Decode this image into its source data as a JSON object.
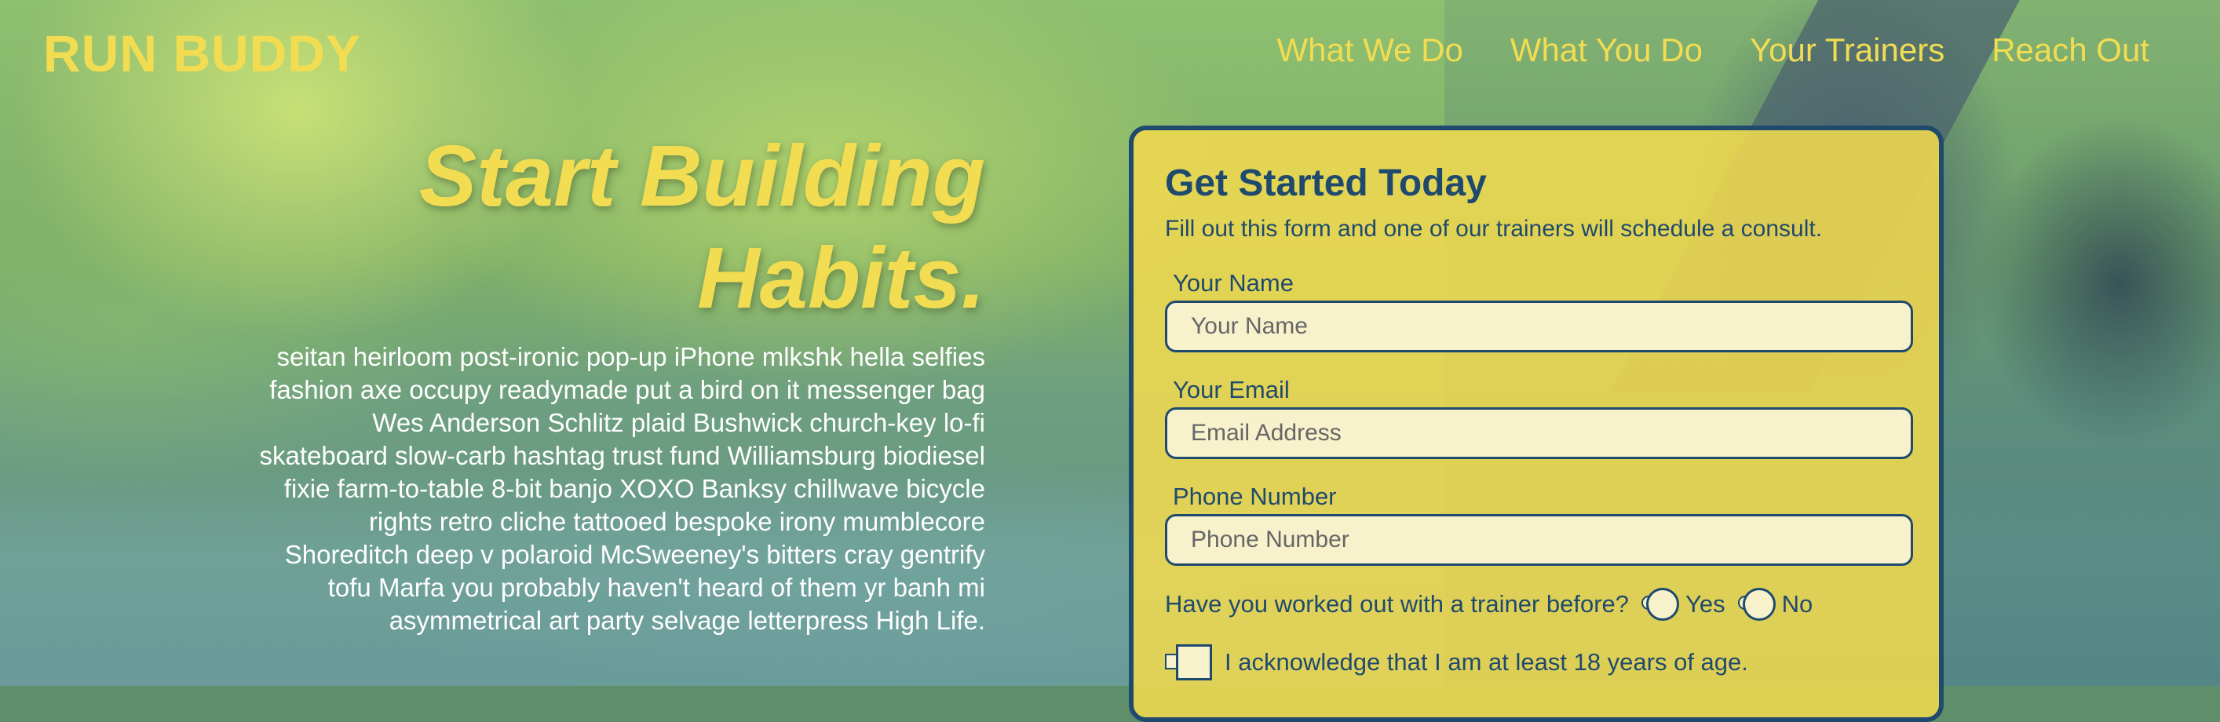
{
  "header": {
    "logo": "RUN BUDDY",
    "nav": [
      "What We Do",
      "What You Do",
      "Your Trainers",
      "Reach Out"
    ]
  },
  "hero": {
    "title_line1": "Start Building",
    "title_line2": "Habits.",
    "body": "seitan heirloom post-ironic pop-up iPhone mlkshk hella selfies fashion axe occupy readymade put a bird on it messenger bag Wes Anderson Schlitz plaid Bushwick church-key lo-fi skateboard slow-carb hashtag trust fund Williamsburg biodiesel fixie farm-to-table 8-bit banjo XOXO Banksy chillwave bicycle rights retro cliche tattooed bespoke irony mumblecore Shoreditch deep v polaroid McSweeney's bitters cray gentrify tofu Marfa you probably haven't heard of them yr banh mi asymmetrical art party selvage letterpress High Life."
  },
  "form": {
    "title": "Get Started Today",
    "subtitle": "Fill out this form and one of our trainers will schedule a consult.",
    "name_label": "Your Name",
    "name_placeholder": "Your Name",
    "email_label": "Your Email",
    "email_placeholder": "Email Address",
    "phone_label": "Phone Number",
    "phone_placeholder": "Phone Number",
    "trainer_question": "Have you worked out with a trainer before?",
    "yes_label": "Yes",
    "no_label": "No",
    "acknowledge": "I acknowledge that I am at least 18 years of age."
  },
  "colors": {
    "brand_yellow": "#f2dd52",
    "brand_navy": "#1f4a6e"
  }
}
